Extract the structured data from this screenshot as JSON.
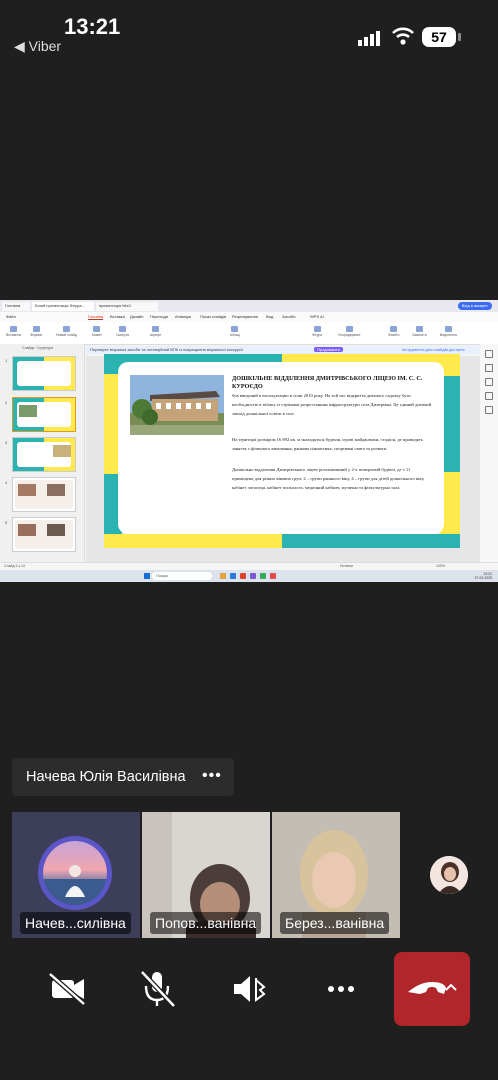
{
  "status_bar": {
    "time": "13:21",
    "back_app": "◀ Viber",
    "battery": "57"
  },
  "shared_screen": {
    "browser_tabs": [
      "Головна",
      "Білий презентація Фігура...",
      "презентація Mix3"
    ],
    "login_button": "Вхід в аккаунт",
    "menu": [
      "Файл",
      "Головна",
      "Вставка",
      "Дизайн",
      "Переходи",
      "Анімація",
      "Показ слайдів",
      "Рецензування",
      "Вид",
      "Засоби",
      "WPS AI"
    ],
    "active_menu_index": 1,
    "ribbon_items": [
      "Вставити",
      "Формат",
      "Новий слайд",
      "Макет",
      "Скинути",
      "Шрифт",
      "Абзац",
      "Фігури",
      "Упорядкувати",
      "Знайти",
      "Замінити",
      "Виділення",
      "Інструменти для слайдів"
    ],
    "notice_text": "Перевірте візуальні засоби та потенційний ВПК із покращення візуальної екскурсії",
    "notice_button": "Продовжити",
    "notice_link": "Інструменти для слайдів доступні",
    "pane_tabs": [
      "Слайди",
      "Структура"
    ],
    "slide_numbers": [
      "1",
      "2",
      "3",
      "4",
      "5"
    ],
    "selected_slide_index": 1,
    "slide": {
      "title": "ДОШКІЛЬНЕ ВІДДІЛЕННЯ ДМИТРІВСЬКОГО  ЛІЦЕЮ ІМ. С. С. КУРОЄДО",
      "paragraphs": [
        " був введений в експлуатацію в січні 2010 року. На той час відкриття дитячого садочку було необхідністю в зв'язку із стрімким розростанням інфраструктури села Дмитрівка. Це єдиний дитячий заклад дошкільної освіти в селі.",
        "    На території розміром 16 892 кв. м знаходяться будівля, ігрові майданчики, стадіон, де проводять заняття з фізичного виховання, ранкова гімнастика, спортивні свята та розваги.",
        "    Дошкільне відділення Дмитрівського ліцею розташований у 2-х поверховій будівлі, де є 11 приміщень для різних вікових груп: 2 – групи раннього віку, 4 – групи для дітей дошкільного віку, кабінет логопеда, кабінет психолога, медичний кабінет, музична та фізкультурна зала."
      ]
    },
    "status_left": "Слайд 2 з 14",
    "status_mid": "Нотатки",
    "status_right": "100%",
    "taskbar_search": "Пошук",
    "clock_time": "13:21",
    "clock_date": "27.02.2025"
  },
  "call": {
    "presenter_name": "Начева Юлія Василівна",
    "more_label": "•••",
    "participants": [
      {
        "label": "Начев...силівна"
      },
      {
        "label": "Попов...ванівна"
      },
      {
        "label": "Берез...ванівна"
      }
    ]
  },
  "colors": {
    "end_call": "#b0262b",
    "slide_teal": "#2bb3b1",
    "slide_yellow": "#ffe94d",
    "call_bg": "#1f1f1f"
  },
  "icons": [
    "video-off-icon",
    "mic-off-icon",
    "speaker-bluetooth-icon",
    "more-icon",
    "end-call-icon",
    "chevron-up-icon"
  ]
}
